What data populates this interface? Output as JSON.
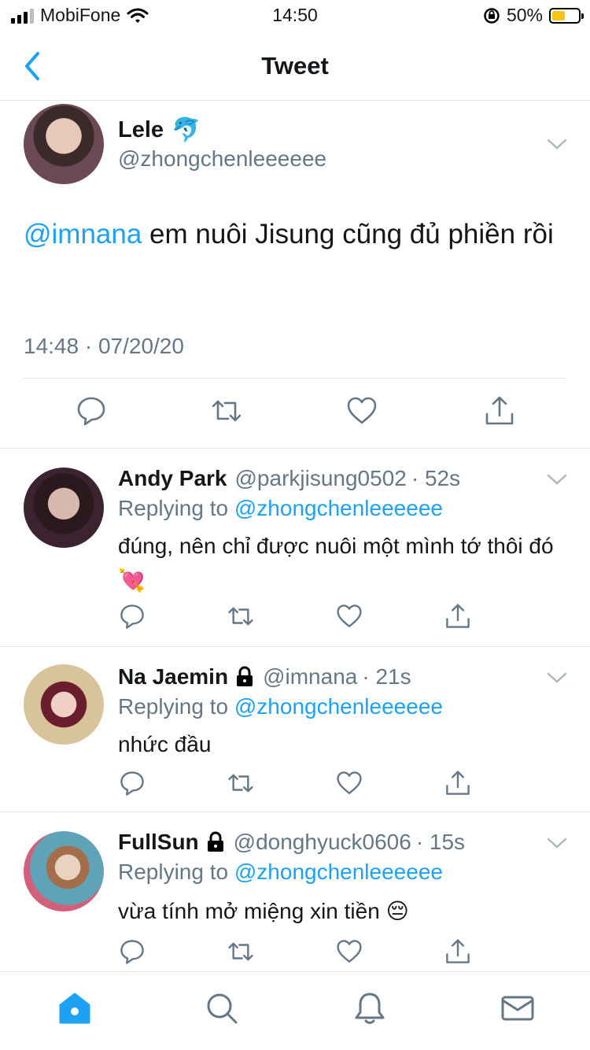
{
  "status_bar": {
    "carrier": "MobiFone",
    "time": "14:50",
    "battery": "50%"
  },
  "nav": {
    "title": "Tweet",
    "back_icon": "chevron-left-icon"
  },
  "main_tweet": {
    "name": "Lele",
    "emoji": "🐬",
    "handle": "@zhongchenleeeeee",
    "mention": "@imnana",
    "text": " em nuôi Jisung cũng đủ phiền rồi",
    "timestamp": "14:48 · 07/20/20"
  },
  "replies": [
    {
      "name": "Andy Park",
      "handle": "@parkjisung0502",
      "age": "· 52s",
      "replying_label": "Replying to",
      "replying_to": "@zhongchenleeeeee",
      "text": "đúng, nên chỉ được nuôi một mình tớ thôi đó 💘",
      "protected": false
    },
    {
      "name": "Na Jaemin",
      "handle": "@imnana",
      "age": "· 21s",
      "replying_label": "Replying to",
      "replying_to": "@zhongchenleeeeee",
      "text": "nhức đầu",
      "protected": true
    },
    {
      "name": "FullSun",
      "handle": "@donghyuck0606",
      "age": "· 15s",
      "replying_label": "Replying to",
      "replying_to": "@zhongchenleeeeee",
      "text": "vừa tính mở miệng xin tiền 😔",
      "protected": true
    }
  ],
  "tabs": [
    "home-icon",
    "search-icon",
    "notifications-icon",
    "messages-icon"
  ],
  "colors": {
    "accent": "#1da1f2",
    "secondary_text": "#657786",
    "divider": "#e1e8ed"
  }
}
